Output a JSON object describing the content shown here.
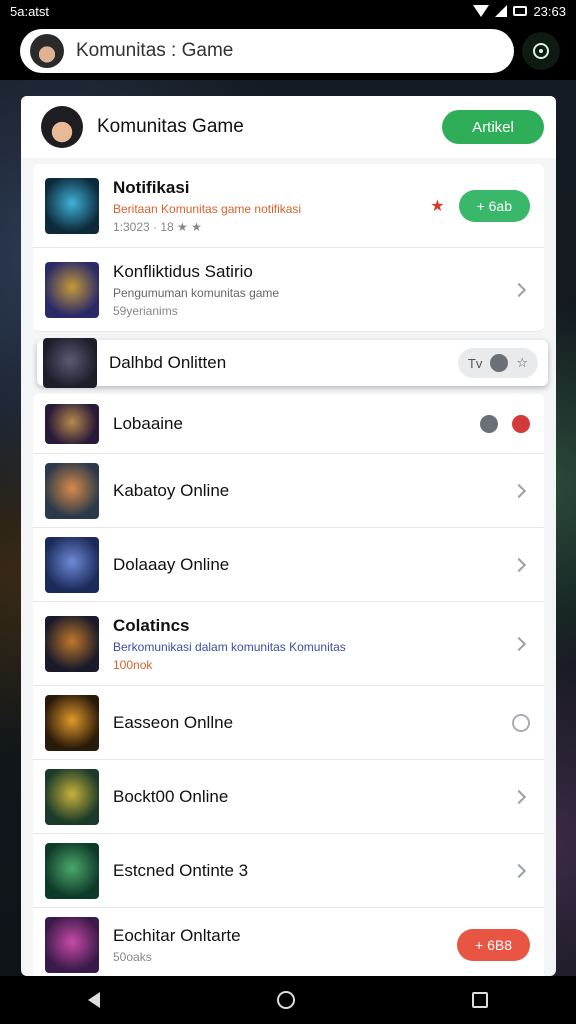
{
  "status_bar": {
    "left_text": "5a:atst",
    "time": "23:63"
  },
  "app_bar": {
    "title": "Komunitas : Game"
  },
  "card": {
    "title": "Komunitas Game",
    "join_label": "Artikel"
  },
  "rows": [
    {
      "name": "Notifikasi",
      "sub": "Beritaan Komunitas game notifikasi",
      "meta": "1:3023 · 18 ★ ★",
      "action": "pill",
      "action_label": "+ 6ab",
      "thumb": [
        "#0d2a3a",
        "#3fb1d8"
      ]
    },
    {
      "name": "Konfliktidus  Satirio",
      "sub": "Pengumuman komunitas game",
      "meta": "59yerianims",
      "action": "chevron",
      "thumb": [
        "#2a2a68",
        "#c49a3a"
      ]
    },
    {
      "name": "Dalhbd Onlitten",
      "action": "chips",
      "chip_text": "Tv",
      "thumb": [
        "#1c1f2a",
        "#5b5a75"
      ]
    },
    {
      "name": "Lobaaine",
      "action": "dots",
      "thumb": [
        "#2a1a3a",
        "#b58a4a"
      ]
    },
    {
      "name": "Kabatoy Online",
      "action": "chevron",
      "thumb": [
        "#2b3a4a",
        "#d88a4a"
      ]
    },
    {
      "name": "Dolaaay Online",
      "action": "chevron",
      "thumb": [
        "#1a2a5a",
        "#6f8ad8"
      ]
    },
    {
      "name": "Colatincs",
      "sub": "Berkomunikasi dalam komunitas Komunitas",
      "meta": "100nok",
      "action": "chevron",
      "thumb": [
        "#1a1a2a",
        "#c0782a"
      ]
    },
    {
      "name": "Easseon Onllne",
      "action": "ring",
      "thumb": [
        "#2a1a0a",
        "#e09a2a"
      ]
    },
    {
      "name": "Bockt00 Online",
      "action": "chevron",
      "thumb": [
        "#1a3a2a",
        "#c9b23a"
      ]
    },
    {
      "name": "Estcned Ontinte 3",
      "action": "chevron",
      "thumb": [
        "#0e3a2a",
        "#4aa86a"
      ]
    },
    {
      "name": "Eochitar Onltarte",
      "meta": "50oaks",
      "action": "pill-red",
      "action_label": "+ 6B8",
      "thumb": [
        "#3a1a4a",
        "#c84aa8"
      ]
    }
  ]
}
